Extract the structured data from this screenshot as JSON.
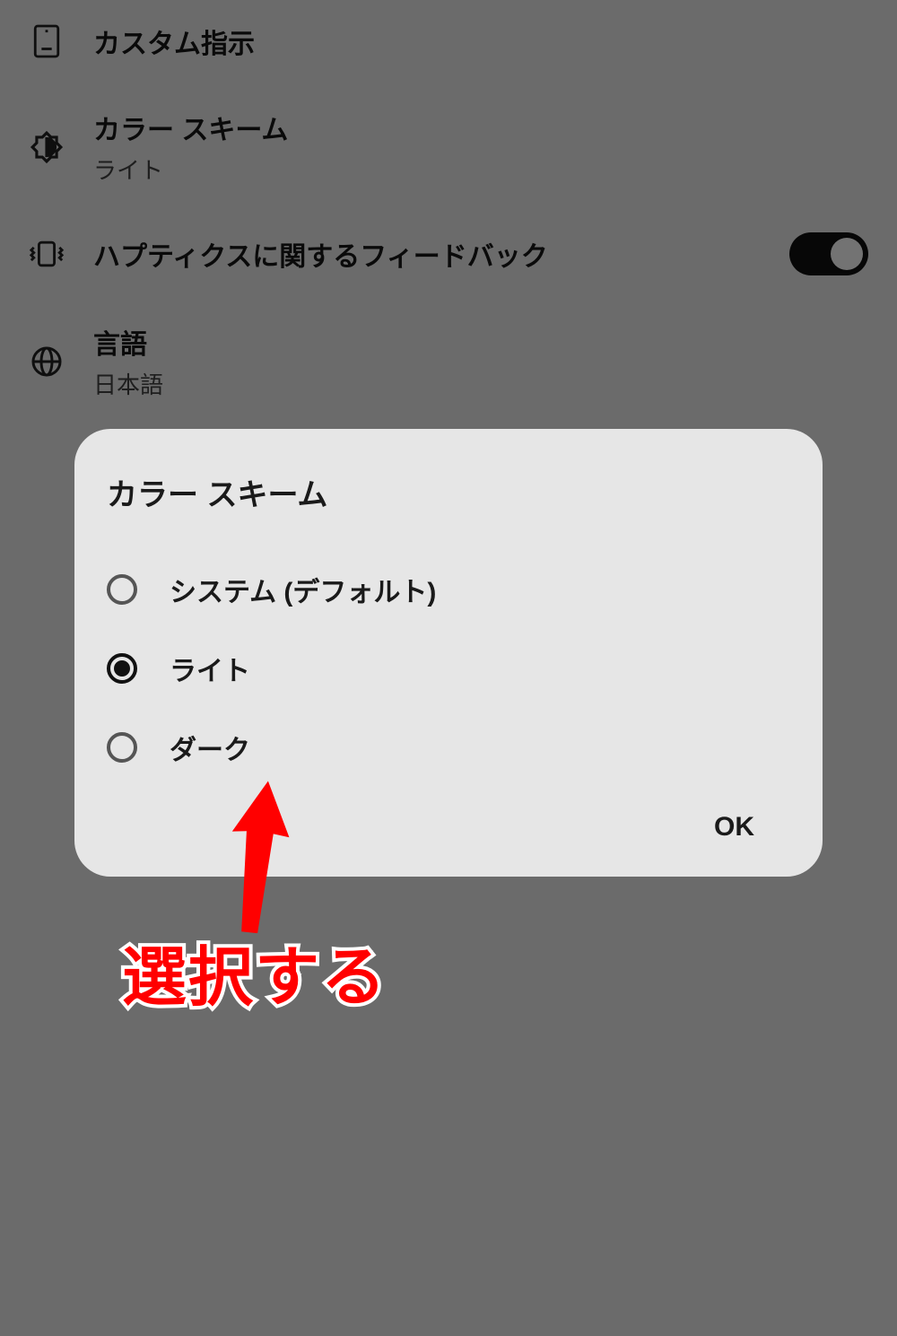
{
  "settings": {
    "custom_instructions": {
      "title": "カスタム指示"
    },
    "color_scheme": {
      "title": "カラー スキーム",
      "value": "ライト"
    },
    "haptics": {
      "title": "ハプティクスに関するフィードバック",
      "enabled": true
    },
    "language": {
      "title": "言語",
      "value": "日本語"
    }
  },
  "dialog": {
    "title": "カラー スキーム",
    "options": [
      {
        "label": "システム (デフォルト)",
        "selected": false
      },
      {
        "label": "ライト",
        "selected": true
      },
      {
        "label": "ダーク",
        "selected": false
      }
    ],
    "ok_label": "OK"
  },
  "annotation": {
    "text": "選択する",
    "arrow_color": "#ff0000"
  }
}
